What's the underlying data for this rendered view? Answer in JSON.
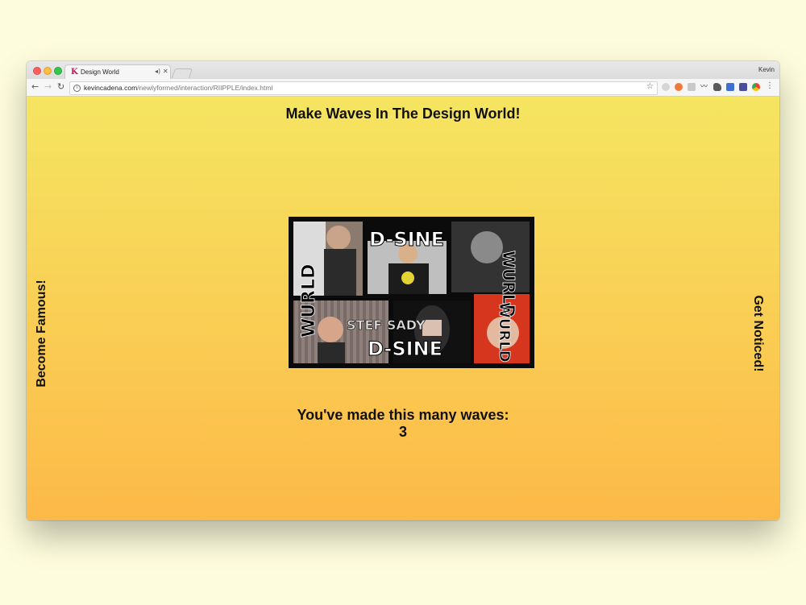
{
  "browser": {
    "tab": {
      "title": "Design World",
      "favicon": "K"
    },
    "profile_name": "Kevin",
    "address": {
      "host": "kevincadena.com",
      "path": "/newlyformed/interaction/RIIPPLE/index.html"
    },
    "extension_icons": [
      "cloud-icon",
      "orange-badge-icon",
      "grey-box-icon",
      "mustache-icon",
      "evernote-icon",
      "info-square-icon",
      "stack-icon",
      "chrome-icon"
    ]
  },
  "page": {
    "heading": "Make Waves In The Design World!",
    "side_left": "Become Famous!",
    "side_right": "Get Noticed!",
    "counter_label": "You've made this many waves:",
    "counter_value": "3"
  },
  "collage": {
    "texts": [
      "D-SINE",
      "WURLD",
      "WURLD",
      "WURLD",
      "STEF SADY",
      "D-SINE"
    ]
  },
  "colors": {
    "gradient_top": "#f5e561",
    "gradient_bottom": "#fdb947",
    "desktop_bg": "#fdfcdc"
  }
}
